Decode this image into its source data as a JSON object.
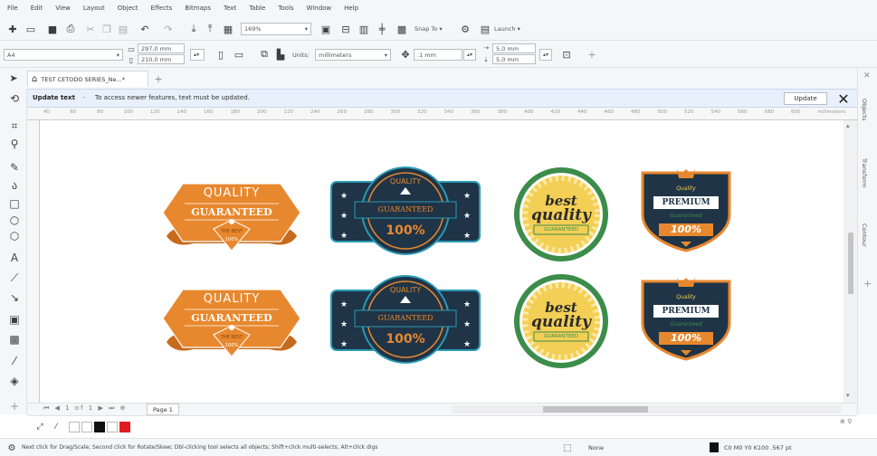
{
  "menu": [
    "File",
    "Edit",
    "View",
    "Layout",
    "Object",
    "Effects",
    "Bitmaps",
    "Text",
    "Table",
    "Tools",
    "Window",
    "Help"
  ],
  "toolbar": {
    "zoom": "169%",
    "snap_to": "Snap To",
    "launch": "Launch"
  },
  "property_bar": {
    "page_size": "A4",
    "width": "297,0 mm",
    "height": "210,0 mm",
    "units_label": "Units:",
    "units_value": "millimeters",
    "nudge": ".1 mm",
    "dup_x": "5,0 mm",
    "dup_y": "5,0 mm"
  },
  "document_tab": "TEST CETODO SERIES_Ne...*",
  "notification": {
    "title": "Update text",
    "message": "To access newer features, text must be updated.",
    "button": "Update"
  },
  "ruler_ticks": [
    "40",
    "60",
    "80",
    "100",
    "120",
    "140",
    "160",
    "180",
    "200",
    "220",
    "240",
    "260",
    "280",
    "300",
    "320",
    "340",
    "360",
    "380",
    "400",
    "420",
    "440",
    "460",
    "480",
    "500",
    "520",
    "540",
    "560",
    "580",
    "600",
    "millimeters"
  ],
  "right_panels": [
    "Objects",
    "Transform",
    "Contour"
  ],
  "page_tab": "Page 1",
  "badges": {
    "b1_line1": "QUALITY",
    "b1_line2": "GUARANTEED",
    "b1_line3": "THE BEST",
    "b1_line4": "100%",
    "b2_line1": "QUALITY",
    "b2_line2": "GUARANTEED",
    "b2_line3": "100%",
    "b3_line1": "best",
    "b3_line2": "quality",
    "b3_line3": "GUARANTEED",
    "b4_line1": "Quality",
    "b4_line2": "PREMIUM",
    "b4_line3": "Guaranteed",
    "b4_line4": "100%"
  },
  "status": {
    "hint": "Next click for Drag/Scale; Second click for Rotate/Skew; Dbl-clicking tool selects all objects; Shift+click multi-selects; Alt+click digs",
    "fill": "None",
    "outline": "C0 M0 Y0 K100 .567 pt"
  },
  "colors": {
    "orange": "#e8882e",
    "navy": "#1f3447",
    "teal": "#2a9ab5",
    "green": "#3c8c4a",
    "yellow": "#f3cf55"
  }
}
